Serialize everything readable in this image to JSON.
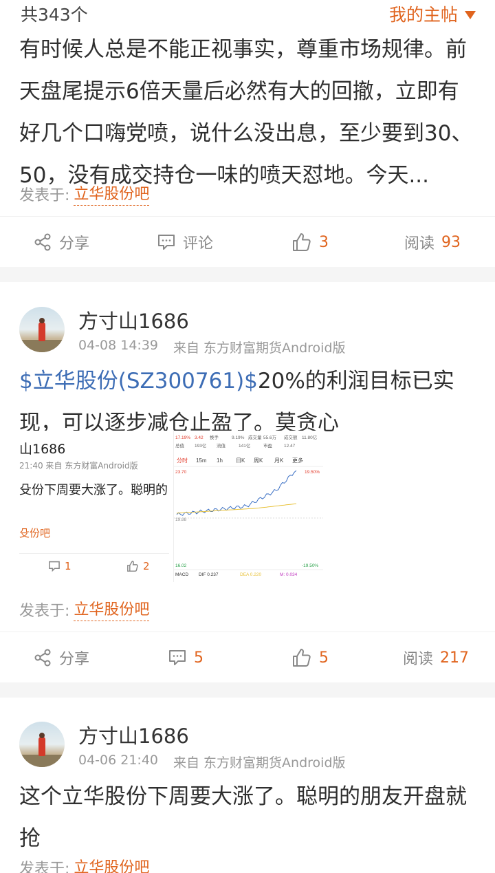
{
  "topbar": {
    "count": "共343个",
    "my_posts": "我的主帖"
  },
  "posts": [
    {
      "text": "有时候人总是不能正视事实，尊重市场规律。前天盘尾提示6倍天量后必然有大的回撤，立即有好几个口嗨党喷，说什么没出息，至少要到30、50，没有成交持仓一味的喷天怼地。今天...",
      "posted_label": "发表于:",
      "bar": "立华股份吧",
      "actions": {
        "share": "分享",
        "comment": "评论",
        "likes": "3",
        "read_label": "阅读",
        "reads": "93"
      }
    },
    {
      "username": "方寸山1686",
      "time": "04-08 14:39",
      "source": "来自 东方财富期货Android版",
      "stock": "$立华股份(SZ300761)$",
      "text": "20%的利润目标已实现，可以逐步减仓止盈了。莫贪心",
      "posted_label": "发表于:",
      "bar": "立华股份吧",
      "actions": {
        "share": "分享",
        "comments": "5",
        "likes": "5",
        "read_label": "阅读",
        "reads": "217"
      },
      "thumb_left": {
        "username": "山1686",
        "meta": "21:40  来自 东方财富Android版",
        "text": "殳份下周要大涨了。聪明的",
        "bar": "殳份吧",
        "comments": "1",
        "likes": "2"
      },
      "thumb_chart": {
        "stats": [
          "17.19%",
          "3.42",
          "换手",
          "9.19%",
          "成交量",
          "55.6万",
          "成交额",
          "11.80亿"
        ],
        "stats2": [
          "总值",
          "193亿",
          "流值",
          "141亿",
          "市盈",
          "12.47"
        ],
        "tabs": [
          "分时",
          "15m",
          "1h",
          "日K",
          "周K",
          "月K",
          "更多"
        ],
        "top_price": "23.70",
        "top_pct": "19.50%",
        "mid_price": "19.88",
        "bottom_price": "16.02",
        "bottom_pct": "-19.50%",
        "macd": "MACD",
        "dif": "DIF 0.237",
        "dea": "DEA 0.220",
        "m": "M: 0.034",
        "colors": {
          "line": "#3a6fc4",
          "avg": "#e8c23a",
          "up": "#e23a2a",
          "down": "#2aa24a"
        }
      }
    },
    {
      "username": "方寸山1686",
      "time": "04-06 21:40",
      "source": "来自 东方财富期货Android版",
      "text": "这个立华股份下周要大涨了。聪明的朋友开盘就抢",
      "posted_label": "发表于:",
      "bar": "立华股份吧"
    }
  ]
}
